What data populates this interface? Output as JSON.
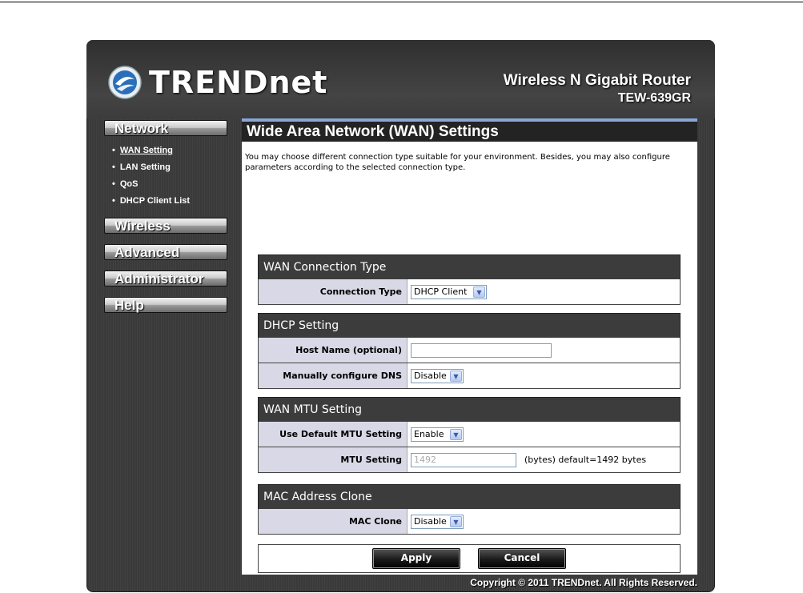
{
  "header": {
    "brand": "TRENDnet",
    "product_line1": "Wireless N Gigabit Router",
    "product_line2": "TEW-639GR"
  },
  "nav": {
    "sections": [
      {
        "label": "Network",
        "subitems": [
          "WAN Setting",
          "LAN Setting",
          "QoS",
          "DHCP Client List"
        ]
      },
      {
        "label": "Wireless"
      },
      {
        "label": "Advanced"
      },
      {
        "label": "Administrator"
      },
      {
        "label": "Help"
      }
    ],
    "active": "WAN Setting"
  },
  "page": {
    "title": "Wide Area Network (WAN) Settings",
    "intro": "You may choose different connection type suitable for your environment. Besides, you may also configure parameters according to the selected connection type."
  },
  "wan_connection": {
    "heading": "WAN Connection Type",
    "connection_type_label": "Connection Type",
    "connection_type_value": "DHCP Client"
  },
  "dhcp": {
    "heading": "DHCP Setting",
    "host_name_label": "Host Name (optional)",
    "host_name_value": "",
    "dns_label": "Manually configure DNS",
    "dns_value": "Disable"
  },
  "mtu": {
    "heading": "WAN MTU Setting",
    "default_label": "Use Default MTU Setting",
    "default_value": "Enable",
    "mtu_label": "MTU Setting",
    "mtu_value": "1492",
    "mtu_hint": "(bytes) default=1492 bytes"
  },
  "mac": {
    "heading": "MAC Address Clone",
    "clone_label": "MAC Clone",
    "clone_value": "Disable"
  },
  "buttons": {
    "apply": "Apply",
    "cancel": "Cancel"
  },
  "footer": {
    "copyright": "Copyright © 2011 TRENDnet. All Rights Reserved."
  },
  "colors": {
    "accent_bar": "#8aa6d6",
    "label_bg": "#d8d8e6",
    "section_bg": "#3c3c3c"
  }
}
